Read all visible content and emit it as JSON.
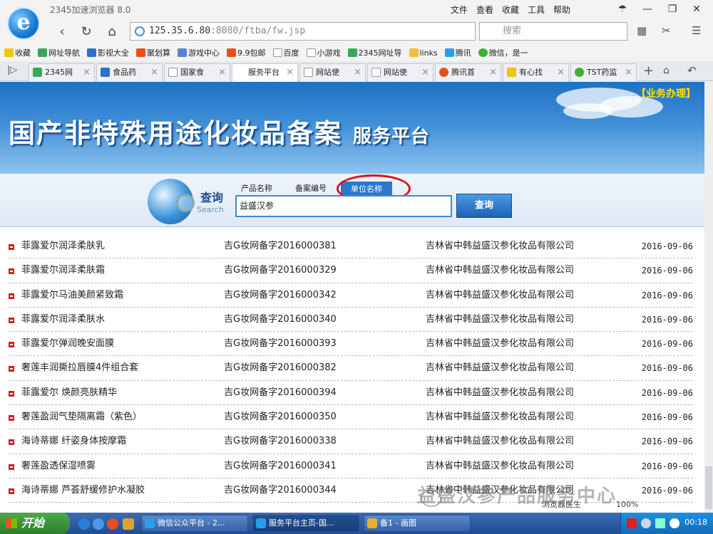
{
  "browser": {
    "app_title": "2345加速浏览器 8.0",
    "menu": [
      "文件",
      "查看",
      "收藏",
      "工具",
      "帮助"
    ],
    "address_host": "125.35.6.80",
    "address_rest": ":8080/ftba/fw.jsp",
    "search_placeholder": "搜索",
    "bookmarks": [
      "收藏",
      "网址导航",
      "影视大全",
      "聚划算",
      "游戏中心",
      "9.9包邮",
      "百度",
      "小游戏",
      "2345网址导",
      "links",
      "腾讯",
      "微信，是一"
    ],
    "tabs": [
      "2345网",
      "食品药",
      "国家食",
      "服务平台",
      "网站使",
      "网站使",
      "腾讯首",
      "有心找",
      "TST药监"
    ],
    "zoom": "100%",
    "status_text": "浏览器医生"
  },
  "page": {
    "biz_link": "【业务办理】",
    "title_main": "国产非特殊用途化妆品备案",
    "title_sub": "服务平台",
    "query_cn": "查询",
    "query_en": "Search",
    "search_tabs": [
      "产品名称",
      "备案编号",
      "单位名称"
    ],
    "query_value": "益盛汉参",
    "query_button": "查询",
    "results": [
      {
        "name": "菲露爱尔润泽柔肤乳",
        "code": "吉G妆网备字2016000381",
        "company": "吉林省中韩益盛汉参化妆品有限公司",
        "date": "2016-09-06"
      },
      {
        "name": "菲露爱尔润泽柔肤霜",
        "code": "吉G妆网备字2016000329",
        "company": "吉林省中韩益盛汉参化妆品有限公司",
        "date": "2016-09-06"
      },
      {
        "name": "菲露爱尔马油美颜紧致霜",
        "code": "吉G妆网备字2016000342",
        "company": "吉林省中韩益盛汉参化妆品有限公司",
        "date": "2016-09-06"
      },
      {
        "name": "菲露爱尔润泽柔肤水",
        "code": "吉G妆网备字2016000340",
        "company": "吉林省中韩益盛汉参化妆品有限公司",
        "date": "2016-09-06"
      },
      {
        "name": "菲露爱尔弹润晚安面膜",
        "code": "吉G妆网备字2016000393",
        "company": "吉林省中韩益盛汉参化妆品有限公司",
        "date": "2016-09-06"
      },
      {
        "name": "奢莲丰润撕拉唇膜4件组合套",
        "code": "吉G妆网备字2016000382",
        "company": "吉林省中韩益盛汉参化妆品有限公司",
        "date": "2016-09-06"
      },
      {
        "name": "菲露爱尔 焕颜亮肤精华",
        "code": "吉G妆网备字2016000394",
        "company": "吉林省中韩益盛汉参化妆品有限公司",
        "date": "2016-09-06"
      },
      {
        "name": "奢莲盈润气垫隔离霜（紫色）",
        "code": "吉G妆网备字2016000350",
        "company": "吉林省中韩益盛汉参化妆品有限公司",
        "date": "2016-09-06"
      },
      {
        "name": "海诗蒂娜 纤姿身体按摩霜",
        "code": "吉G妆网备字2016000338",
        "company": "吉林省中韩益盛汉参化妆品有限公司",
        "date": "2016-09-06"
      },
      {
        "name": "奢莲盈透保湿喷雾",
        "code": "吉G妆网备字2016000341",
        "company": "吉林省中韩益盛汉参化妆品有限公司",
        "date": "2016-09-06"
      },
      {
        "name": "海诗蒂娜 芦荟舒缓修护水凝胶",
        "code": "吉G妆网备字2016000344",
        "company": "吉林省中韩益盛汉参化妆品有限公司",
        "date": "2016-09-06"
      }
    ],
    "watermark": "益盛汉参产品服务中心"
  },
  "taskbar": {
    "start": "开始",
    "tasks": [
      "微信公众平台 - 2...",
      "服务平台主页-国...",
      "备1 - 画图"
    ],
    "clock": "00:18"
  },
  "colors": {
    "accent": "#2a78cc",
    "highlight_ring": "#e0101a",
    "bullet": "#d21e1e",
    "banner": "#1f72c2"
  }
}
